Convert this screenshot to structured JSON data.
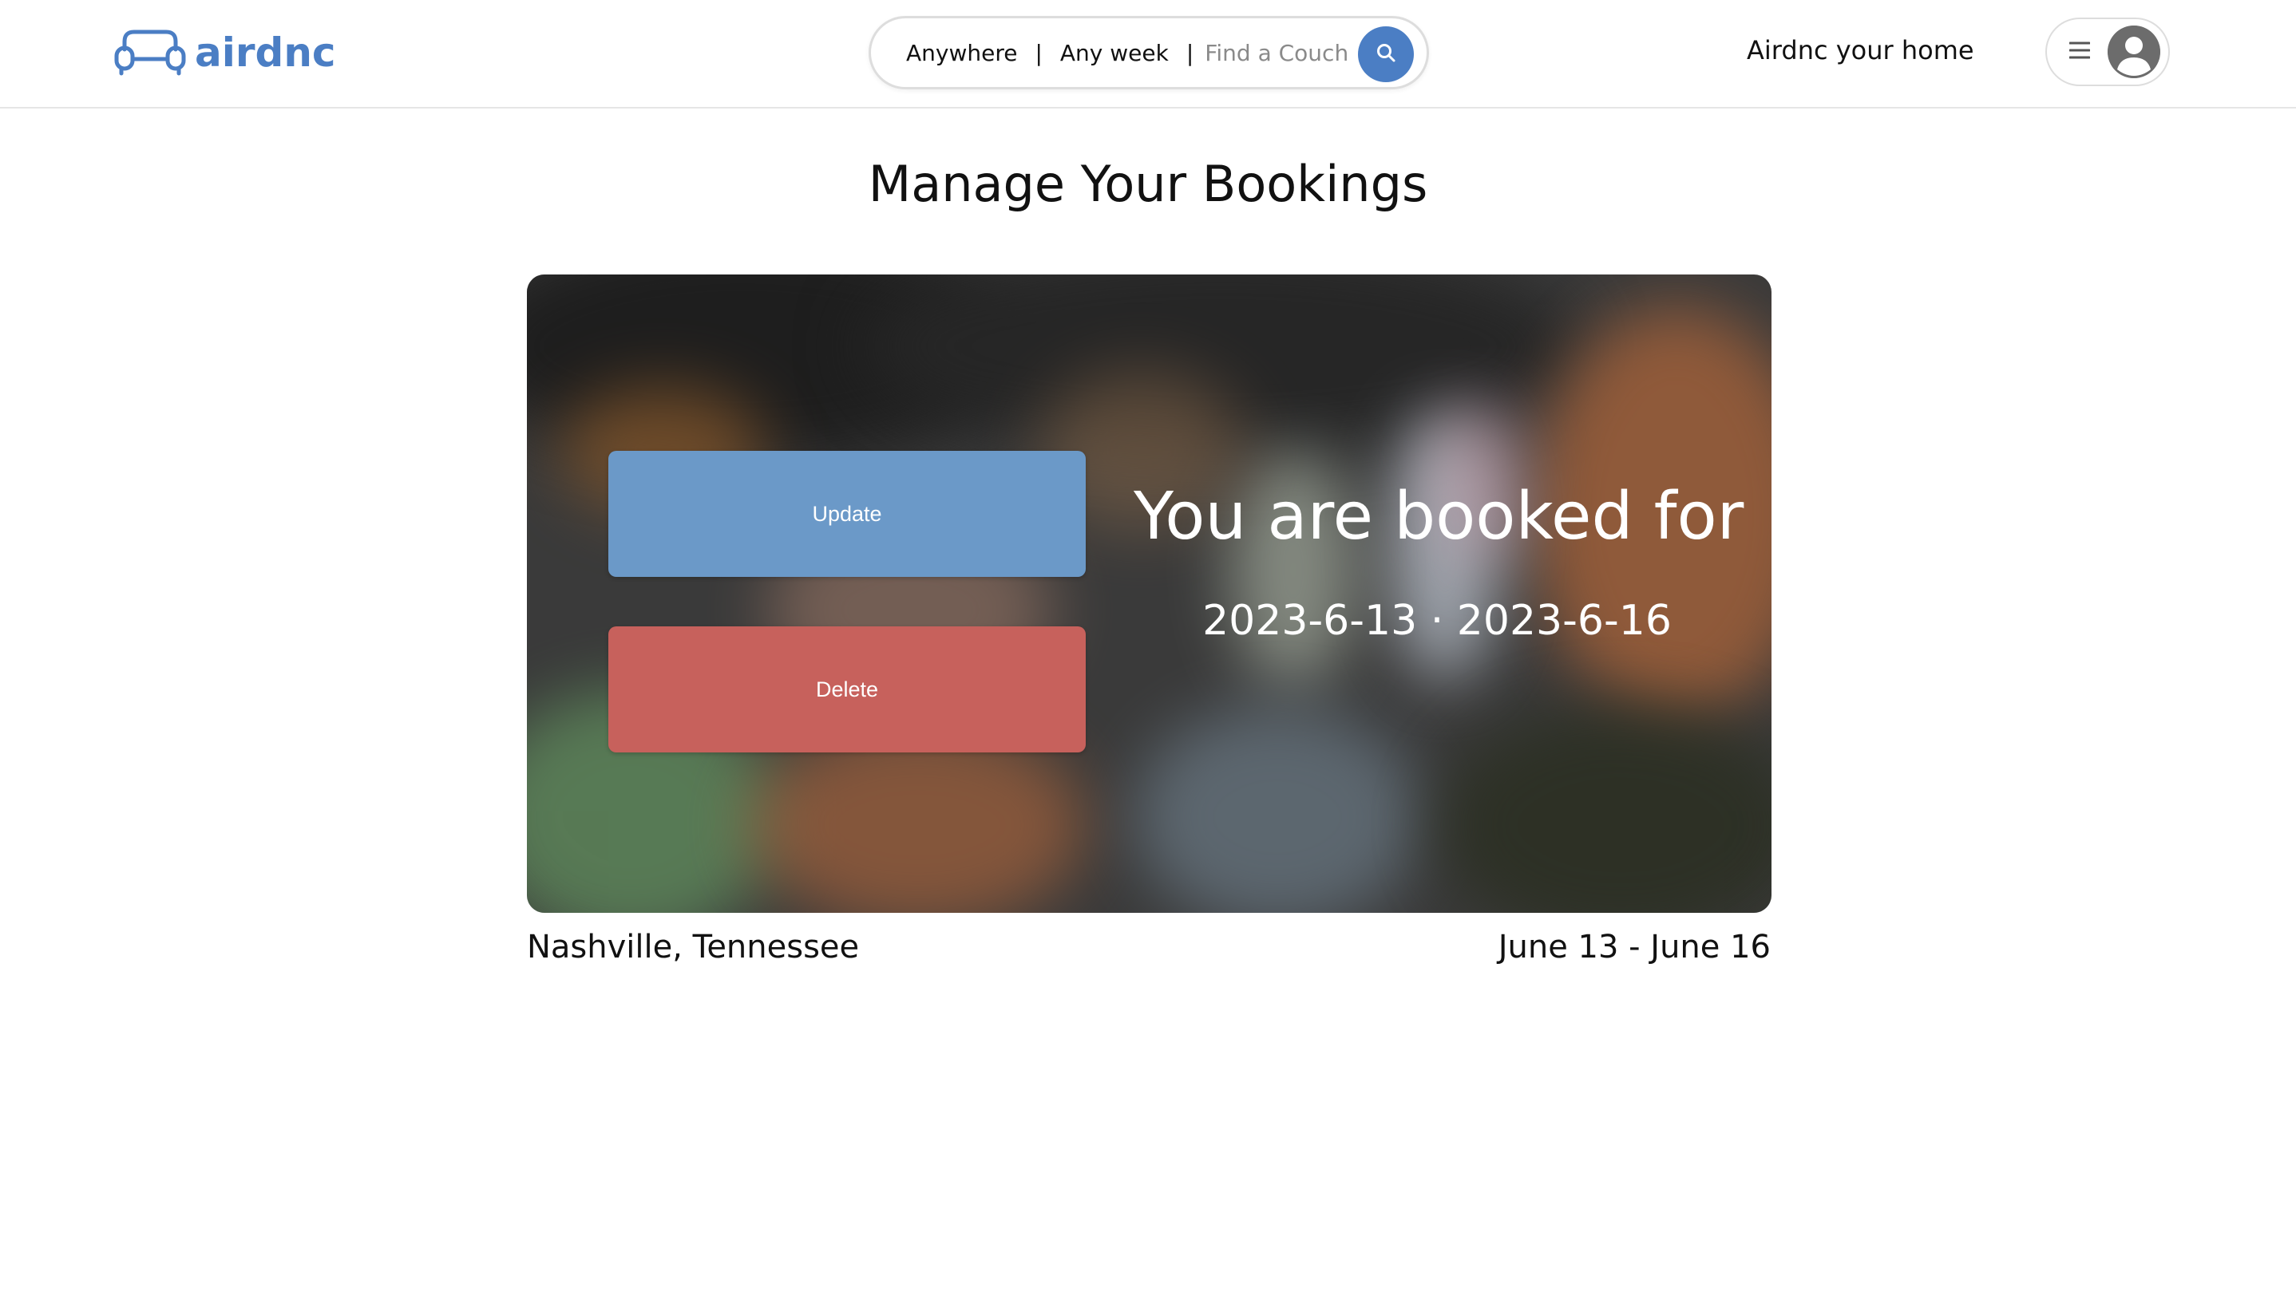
{
  "header": {
    "logo_text": "airdnc",
    "search": {
      "anywhere_label": "Anywhere",
      "separator": "|",
      "week_label": "Any week",
      "input_placeholder": "Find a Couch",
      "input_value": ""
    },
    "host_link": "Airdnc your home",
    "icons": {
      "logo": "couch-icon",
      "search": "search-icon",
      "menu": "hamburger-menu-icon",
      "avatar": "user-avatar-icon"
    }
  },
  "main": {
    "title": "Manage Your Bookings",
    "booking": {
      "update_label": "Update",
      "delete_label": "Delete",
      "headline": "You are booked for",
      "date_range": "2023-6-13 · 2023-6-16",
      "location": "Nashville, Tennessee",
      "dates_label": "June 13 - June 16"
    }
  },
  "colors": {
    "brand": "#4b7ec4",
    "update_button": "#6b99c8",
    "delete_button": "#c7615c"
  }
}
